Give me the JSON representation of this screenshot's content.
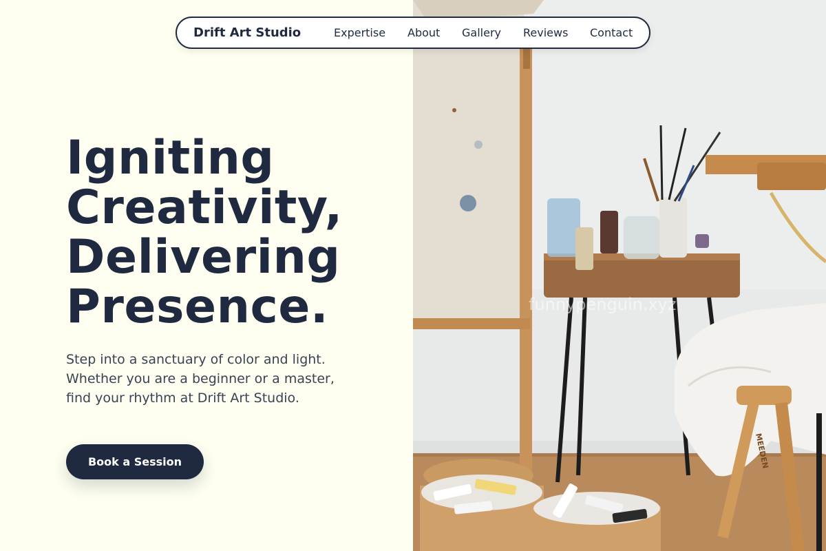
{
  "nav": {
    "brand": "Drift Art Studio",
    "links": [
      {
        "label": "Expertise"
      },
      {
        "label": "About"
      },
      {
        "label": "Gallery"
      },
      {
        "label": "Reviews"
      },
      {
        "label": "Contact"
      }
    ]
  },
  "hero": {
    "headline_lines": [
      "Igniting",
      "Creativity,",
      "Delivering",
      "Presence."
    ],
    "intro": "Step into a sanctuary of color and light. Whether you are a beginner or a master, find your rhythm at Drift Art Studio.",
    "cta_label": "Book a Session"
  },
  "image": {
    "watermark": "funnypenguin.xyz",
    "stool_brand": "MEEDEN"
  },
  "colors": {
    "background": "#fefff0",
    "primary": "#1f2a40",
    "body_text": "#3a4254"
  }
}
